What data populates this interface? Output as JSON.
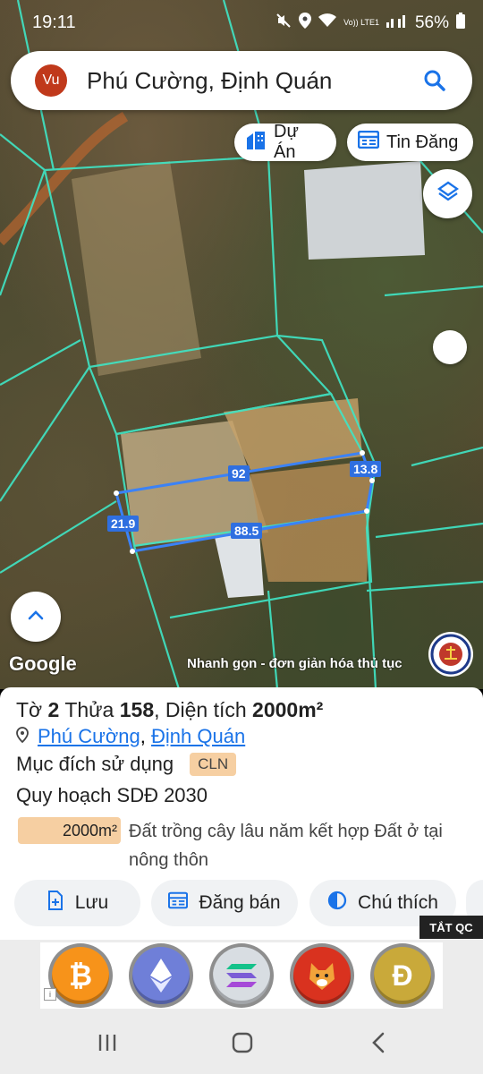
{
  "status_bar": {
    "time": "19:11",
    "network": "Vo)) LTE1",
    "battery": "56%"
  },
  "search": {
    "avatar": "Vu",
    "query": "Phú Cường, Định Quán"
  },
  "map": {
    "chips": [
      {
        "label": "Dự Án",
        "icon": "building-icon"
      },
      {
        "label": "Tin Đăng",
        "icon": "listing-icon"
      }
    ],
    "dimensions": {
      "top": "92",
      "right": "13.8",
      "bottom": "88.5",
      "left": "21.9"
    },
    "google": "Google",
    "tagline": "Nhanh gọn - đơn giản hóa thủ tục"
  },
  "parcel": {
    "sheet_label": "Tờ",
    "sheet_no": "2",
    "lot_label": "Thửa",
    "lot_no": "158",
    "area_label": "Diện tích",
    "area": "2000m²",
    "ward": "Phú Cường",
    "sep": ",",
    "district": "Định Quán",
    "purpose_label": "Mục đích sử dụng",
    "purpose_code": "CLN",
    "plan_label": "Quy hoạch SDĐ 2030",
    "plan_area": "2000m²",
    "plan_desc": "Đất trồng cây lâu năm kết hợp Đất ở tại nông thôn"
  },
  "actions": {
    "save": "Lưu",
    "sell": "Đăng bán",
    "legend": "Chú thích"
  },
  "ad": {
    "close": "TẮT QC",
    "coins": [
      "bitcoin-icon",
      "ethereum-icon",
      "solana-icon",
      "shiba-icon",
      "dogecoin-icon"
    ]
  },
  "colors": {
    "accent": "#1a73e8",
    "parcel_line": "#3b82f6",
    "plot_border": "#40e0c0",
    "badge": "#f6cfa2"
  }
}
